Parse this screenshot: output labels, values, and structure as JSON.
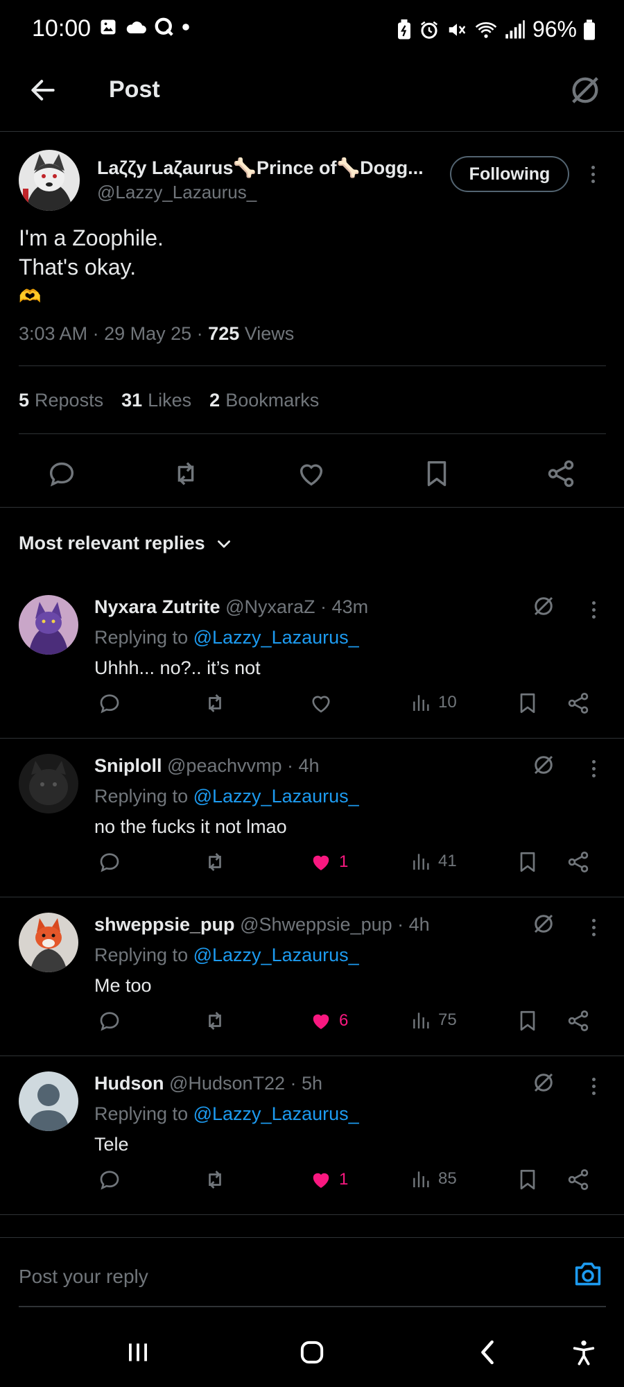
{
  "status_bar": {
    "time": "10:00",
    "battery": "96%"
  },
  "header": {
    "title": "Post"
  },
  "post": {
    "author_name": "Laζζy Laζaurus🦴Prince of🦴Dogg...",
    "author_handle": "@Lazzy_Lazaurus_",
    "follow_label": "Following",
    "text_lines": [
      "I'm a Zoophile.",
      "That's okay.",
      "🫶"
    ],
    "time": "3:03 AM",
    "date": "29 May 25",
    "views": "725",
    "views_label": "Views",
    "reposts": "5",
    "reposts_label": "Reposts",
    "likes": "31",
    "likes_label": "Likes",
    "bookmarks": "2",
    "bookmarks_label": "Bookmarks"
  },
  "replies_sort": "Most relevant replies",
  "replies": [
    {
      "name": "Nyxara Zutrite",
      "handle": "@NyxaraZ",
      "age": "43m",
      "replying_prefix": "Replying to",
      "replying_to": "@Lazzy_Lazaurus_",
      "text": "Uhhh... no?.. it’s not",
      "likes": "",
      "liked": false,
      "views": "10"
    },
    {
      "name": "Sniploll",
      "handle": "@peachvvmp",
      "age": "4h",
      "replying_prefix": "Replying to",
      "replying_to": "@Lazzy_Lazaurus_",
      "text": "no the fucks it not lmao",
      "likes": "1",
      "liked": true,
      "views": "41"
    },
    {
      "name": "shweppsie_pup",
      "handle": "@Shweppsie_pup",
      "age": "4h",
      "replying_prefix": "Replying to",
      "replying_to": "@Lazzy_Lazaurus_",
      "text": "Me too",
      "likes": "6",
      "liked": true,
      "views": "75"
    },
    {
      "name": "Hudson",
      "handle": "@HudsonT22",
      "age": "5h",
      "replying_prefix": "Replying to",
      "replying_to": "@Lazzy_Lazaurus_",
      "text": "Tele",
      "likes": "1",
      "liked": true,
      "views": "85"
    }
  ],
  "compose": {
    "placeholder": "Post your reply"
  },
  "colors": {
    "background": "#000000",
    "text": "#e7e9ea",
    "muted": "#71767b",
    "link": "#1d9bf0",
    "like": "#f91880",
    "divider": "#2f3336"
  },
  "icons": {
    "back": "arrow-left-icon",
    "grok": "grok-slash-circle-icon",
    "reply": "speech-bubble-icon",
    "repost": "repost-arrows-icon",
    "like": "heart-icon",
    "views": "bar-chart-icon",
    "bookmark": "bookmark-icon",
    "share": "share-nodes-icon",
    "camera": "camera-icon"
  }
}
